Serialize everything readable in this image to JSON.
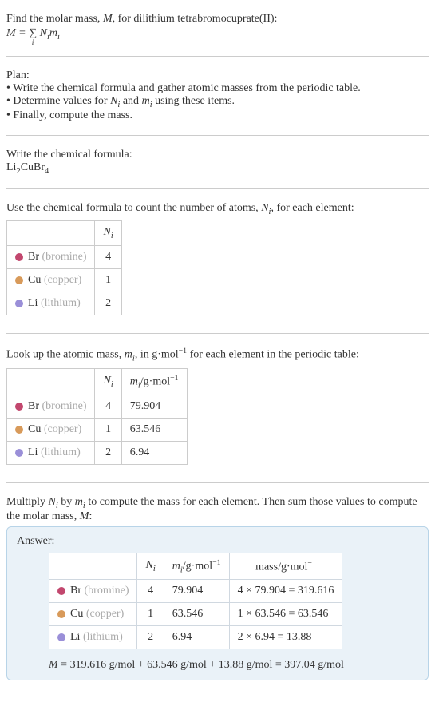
{
  "intro": {
    "line1_a": "Find the molar mass, ",
    "line1_b": ", for dilithium tetrabromocuprate(II):",
    "M": "M",
    "eq": " = ",
    "sigma": "∑",
    "sigma_sub": "i",
    "Ni": "N",
    "Ni_sub": "i",
    "mi": "m",
    "mi_sub": "i"
  },
  "plan": {
    "heading": "Plan:",
    "item1": "• Write the chemical formula and gather atomic masses from the periodic table.",
    "item2a": "• Determine values for ",
    "item2b": " and ",
    "item2c": " using these items.",
    "item3": "• Finally, compute the mass."
  },
  "chemformula": {
    "heading": "Write the chemical formula:",
    "li": "Li",
    "li_sub": "2",
    "cu": "Cu",
    "br": "Br",
    "br_sub": "4"
  },
  "count": {
    "heading_a": "Use the chemical formula to count the number of atoms, ",
    "heading_b": ", for each element:",
    "col_ni": "N",
    "col_ni_sub": "i",
    "rows": [
      {
        "sym": "Br",
        "name": "(bromine)",
        "n": "4",
        "bclass": "bullet-br"
      },
      {
        "sym": "Cu",
        "name": "(copper)",
        "n": "1",
        "bclass": "bullet-cu"
      },
      {
        "sym": "Li",
        "name": "(lithium)",
        "n": "2",
        "bclass": "bullet-li"
      }
    ]
  },
  "lookup": {
    "heading_a": "Look up the atomic mass, ",
    "heading_b": ", in g·mol",
    "heading_c": " for each element in the periodic table:",
    "sup_neg1": "−1",
    "col_mi": "m",
    "col_mi_sub": "i",
    "col_mi_unit_a": "/g·mol",
    "rows": [
      {
        "sym": "Br",
        "name": "(bromine)",
        "n": "4",
        "m": "79.904",
        "bclass": "bullet-br"
      },
      {
        "sym": "Cu",
        "name": "(copper)",
        "n": "1",
        "m": "63.546",
        "bclass": "bullet-cu"
      },
      {
        "sym": "Li",
        "name": "(lithium)",
        "n": "2",
        "m": "6.94",
        "bclass": "bullet-li"
      }
    ]
  },
  "multiply": {
    "text_a": "Multiply ",
    "text_b": " by ",
    "text_c": " to compute the mass for each element. Then sum those values to compute the molar mass, ",
    "text_d": ":"
  },
  "answer": {
    "label": "Answer:",
    "col_mass_a": "mass/g·mol",
    "rows": [
      {
        "sym": "Br",
        "name": "(bromine)",
        "n": "4",
        "m": "79.904",
        "mass": "4 × 79.904 = 319.616",
        "bclass": "bullet-br"
      },
      {
        "sym": "Cu",
        "name": "(copper)",
        "n": "1",
        "m": "63.546",
        "mass": "1 × 63.546 = 63.546",
        "bclass": "bullet-cu"
      },
      {
        "sym": "Li",
        "name": "(lithium)",
        "n": "2",
        "m": "6.94",
        "mass": "2 × 6.94 = 13.88",
        "bclass": "bullet-li"
      }
    ],
    "final_a": "M",
    "final_b": " = 319.616 g/mol + 63.546 g/mol + 13.88 g/mol = 397.04 g/mol"
  }
}
